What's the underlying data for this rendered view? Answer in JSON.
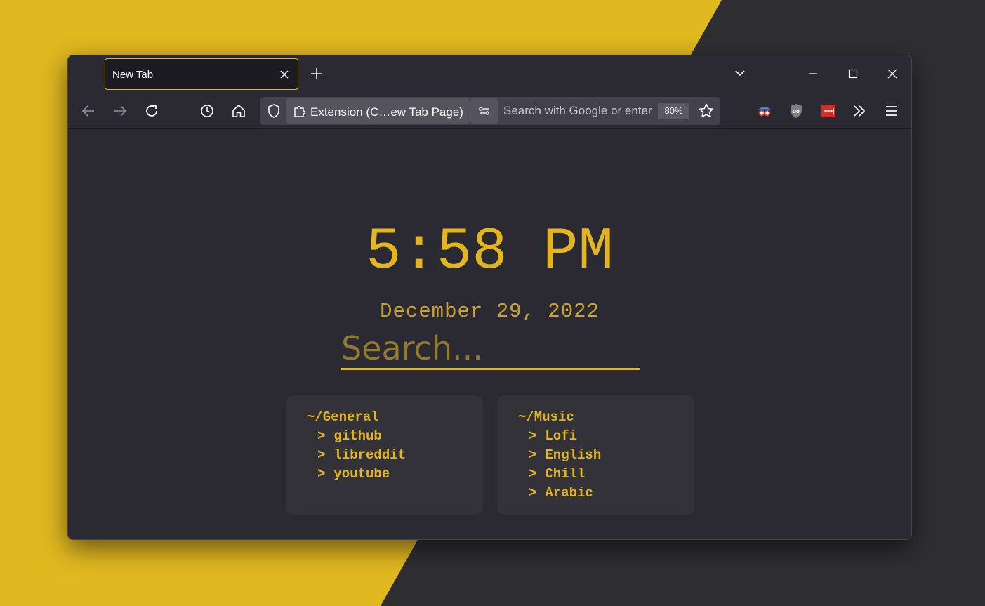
{
  "theme": {
    "accent": "#e3b621",
    "background": "#2b2a33",
    "card": "#333238",
    "desktop_yellow": "#e0b820",
    "desktop_dark": "#2f2f31"
  },
  "tab": {
    "title": "New Tab",
    "close_icon": "close-icon"
  },
  "toolbar": {
    "identity_label": "Extension (C…ew Tab Page)",
    "address_placeholder": "Search with Google or enter address",
    "zoom": "80%",
    "icons": [
      "back-arrow-icon",
      "forward-arrow-icon",
      "reload-icon",
      "history-icon",
      "home-icon",
      "shield-icon",
      "puzzle-icon",
      "permissions-icon",
      "star-icon",
      "spy-glasses-icon",
      "ublock-icon",
      "password-manager-icon",
      "overflow-chevrons-icon",
      "hamburger-menu-icon"
    ]
  },
  "page": {
    "time": "5:58 PM",
    "date": "December 29, 2022",
    "search_placeholder": "Search...",
    "link_arrow": ">",
    "groups": [
      {
        "title": "~/General",
        "links": [
          "github",
          "libreddit",
          "youtube"
        ]
      },
      {
        "title": "~/Music",
        "links": [
          "Lofi",
          "English",
          "Chill",
          "Arabic"
        ]
      }
    ]
  }
}
